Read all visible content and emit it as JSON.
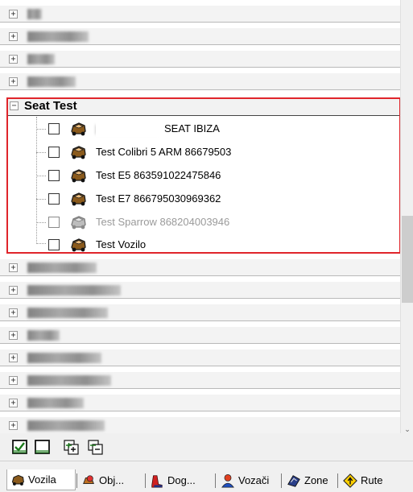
{
  "tree": {
    "open_group": {
      "title": "Seat Test",
      "expander": "−"
    },
    "collapsed_expander": "+",
    "vehicles": [
      {
        "label": "SEAT IBIZA",
        "prefix_redacted": true,
        "enabled": true
      },
      {
        "label": "Test Colibri 5 ARM 86679503",
        "enabled": true
      },
      {
        "label": "Test E5 863591022475846",
        "enabled": true
      },
      {
        "label": "Test E7 866795030969362",
        "enabled": true
      },
      {
        "label": "Test Sparrow 868204003946",
        "enabled": false
      },
      {
        "label": "Test Vozilo",
        "enabled": true
      }
    ]
  },
  "toolbar": {
    "buttons": [
      "check-all-icon",
      "uncheck-all-icon",
      "expand-all-icon",
      "collapse-all-icon"
    ]
  },
  "tabs": [
    {
      "label": "Vozila",
      "icon": "car-icon",
      "active": true
    },
    {
      "label": "Obj...",
      "icon": "objects-icon",
      "active": false
    },
    {
      "label": "Dog...",
      "icon": "events-icon",
      "active": false
    },
    {
      "label": "Vozači",
      "icon": "driver-icon",
      "active": false
    },
    {
      "label": "Zone",
      "icon": "zone-icon",
      "active": false
    },
    {
      "label": "Rute",
      "icon": "route-icon",
      "active": false
    }
  ],
  "colors": {
    "highlight_border": "#e0252b",
    "tree_line": "#9a9a9a",
    "disabled_text": "#9a9a9a"
  }
}
